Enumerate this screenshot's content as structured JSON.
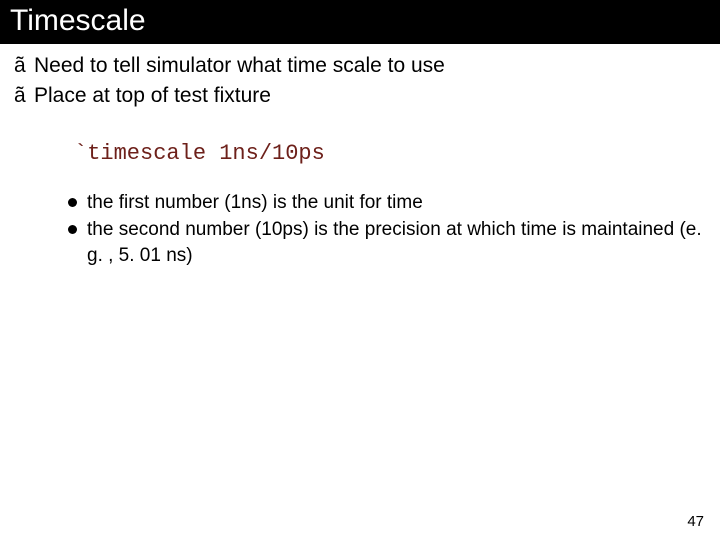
{
  "header": {
    "title": "Timescale"
  },
  "bullets": {
    "glyph": "ã",
    "items": [
      "Need to tell simulator what time scale to use",
      "Place at top of test fixture"
    ]
  },
  "code": "`timescale 1ns/10ps",
  "subbullets": {
    "items": [
      "the first number (1ns) is the unit for time",
      "the second number (10ps) is the precision at which time is maintained (e. g. , 5. 01 ns)"
    ]
  },
  "page": "47"
}
